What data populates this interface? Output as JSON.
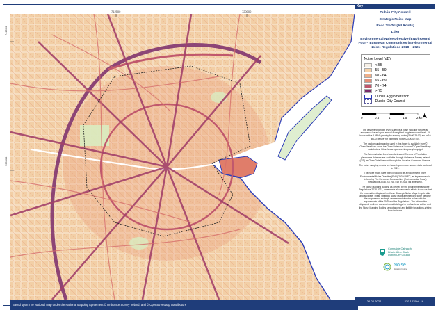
{
  "panel": {
    "key_label": "Key",
    "org": "Dublin City Council",
    "map_title": "Strategic Noise Map",
    "subtitle": "Road Traffic (All Roads)",
    "indicator": "Lden",
    "directive": "Environmental Noise Directive (END) Round Four – European Communities (Environmental Noise) Regulations 2018 – 2021",
    "footer_date": "26-02-2022",
    "footer_ref": "220-1235hA-16"
  },
  "legend": {
    "title": "Noise Level (dB)",
    "items": [
      {
        "label": "< 55",
        "color": "#f7f0e6"
      },
      {
        "label": "55 - 59",
        "color": "#f6d2a9"
      },
      {
        "label": "60 - 64",
        "color": "#efae87"
      },
      {
        "label": "65 - 69",
        "color": "#e58d75"
      },
      {
        "label": "70 - 74",
        "color": "#c0586d"
      },
      {
        "label": "> 75",
        "color": "#7a2b6b"
      },
      {
        "label": "Dublin Agglomeration",
        "color": "#2c3db8"
      },
      {
        "label": "Dublin City Council",
        "color": "#5a5a9c"
      }
    ]
  },
  "scale": {
    "ticks": [
      "0",
      "0.5",
      "1",
      "1.5",
      "2 km"
    ]
  },
  "notes": [
    "The day-evening-night level (Lden) is a noise indicator for overall annoyance based upon annual A-weighted long term sound level. 24 hours with a 5 dB(A) penalty for evening noise (19:00-23:00) and a 10 dB(A) penalty for night time noise (23:00-07:00).",
    "The background mapping used in this figure is available from © OpenStreetMap under the Open Database Licence © OpenStreetMap contributors. https://www.openstreetmap.org/copyright",
    "The Administrative Area boundaries and Centres of Population placename datasets are available through Ordnance Survey Ireland (OSi) as Open Data licensed through the Creative Commons Licence.",
    "The noise mapping results are based upon model source data captured in 2021.",
    "The noise maps have been produced as a requirement of the Environmental Noise Directive (END) 2002/49/EC, as implemented in Ireland by The European Communities (Environmental Noise) Regulations 2018, S.I. No. 549 of 2018 (as amended).",
    "The Noise Mapping Bodies, as defined by the Environmental Noise Regulations 2018-2021, have made all reasonable efforts to ensure that the information displayed on these Strategic Noise Maps is up to date and accurate. These Strategic Noise Maps are intended to be used for the purposes of strategic assessment of noise in line with the requirements of the END and the Regulations. The information displayed on them does not constitute legal or professional advice and the Noise Mapping Bodies cannot accept any liability for actions arising from their use."
  ],
  "logos": {
    "council_lines": [
      "Comhairle Cathrach",
      "Bhaile Átha Cliath",
      "Dublin City Council"
    ],
    "noise_label": "Noise",
    "noise_sub": "Mapping Ireland"
  },
  "map": {
    "coord_top_1": "712500",
    "coord_top_2": "720000",
    "coord_left_1": "742500",
    "coord_left_2": "735000",
    "footer": "Based upon The National Map under the National Mapping Agreement © Ordnance Survey Ireland, and © OpenStreetMap contributors"
  }
}
